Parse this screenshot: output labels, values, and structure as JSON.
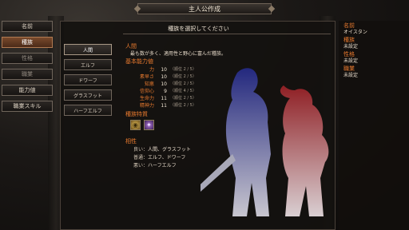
{
  "window": {
    "title": "主人公作成"
  },
  "left_menu": {
    "items": [
      {
        "label": "名前"
      },
      {
        "label": "種族"
      },
      {
        "label": "性格"
      },
      {
        "label": "職業"
      },
      {
        "label": "能力値"
      },
      {
        "label": "職業スキル"
      }
    ]
  },
  "panel": {
    "title": "種族を選択してください"
  },
  "races": [
    "人間",
    "エルフ",
    "ドワーフ",
    "グラスフット",
    "ハーフエルフ"
  ],
  "race_info": {
    "name": "人間",
    "description": "最も数が多く、適用性と野心に富んだ種族。",
    "stats_header": "基本能力値",
    "stats": [
      {
        "name": "力",
        "value": "10",
        "rank": "（順位 2 / 5）"
      },
      {
        "name": "素早さ",
        "value": "10",
        "rank": "（順位 2 / 5）"
      },
      {
        "name": "知恵",
        "value": "10",
        "rank": "（順位 2 / 5）"
      },
      {
        "name": "信仰心",
        "value": "9",
        "rank": "（順位 4 / 5）"
      },
      {
        "name": "生命力",
        "value": "11",
        "rank": "（順位 2 / 5）"
      },
      {
        "name": "精神力",
        "value": "11",
        "rank": "（順位 2 / 5）"
      }
    ],
    "traits_header": "種族特質",
    "trait_icons": [
      "trait-icon-gold",
      "trait-icon-purple"
    ],
    "compat_header": "相性",
    "compat": [
      {
        "label": "良い：",
        "value": "人間、グラスフット"
      },
      {
        "label": "普通：",
        "value": "エルフ、ドワーフ"
      },
      {
        "label": "悪い：",
        "value": "ハーフエルフ"
      }
    ]
  },
  "summary": {
    "name_label": "名前",
    "name_value": "オイスタン",
    "race_label": "種族",
    "race_value": "未設定",
    "personality_label": "性格",
    "personality_value": "未設定",
    "class_label": "職業",
    "class_value": "未設定"
  },
  "colors": {
    "accent": "#e7792e",
    "active_tab": "#7a4a2c",
    "silhouette_blue": "#2a2f8a",
    "silhouette_red": "#9a2a2a"
  }
}
